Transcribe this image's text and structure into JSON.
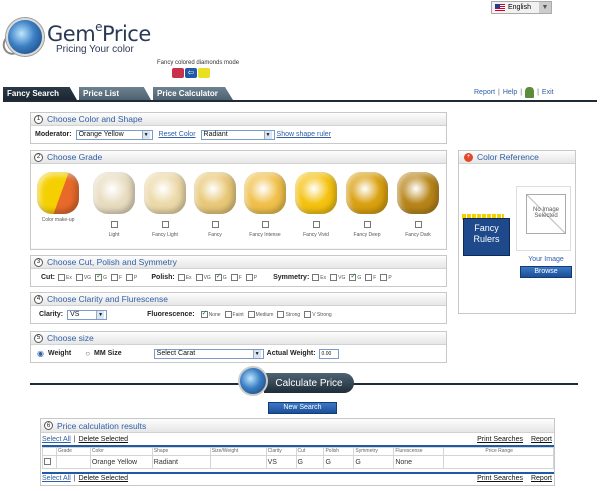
{
  "brand": {
    "name_pre": "Gem",
    "name_sup": "e",
    "name_post": "Price",
    "tagline": "Pricing Your color"
  },
  "language": {
    "selected": "English"
  },
  "mode": {
    "label": "Fancy colored diamonds mode"
  },
  "tabs": [
    {
      "label": "Fancy Search",
      "active": true
    },
    {
      "label": "Price List",
      "active": false
    },
    {
      "label": "Price Calculator",
      "active": false
    }
  ],
  "toplinks": {
    "report": "Report",
    "help": "Help",
    "exit": "Exit",
    "sep": "|"
  },
  "sections": {
    "color": {
      "num": "1",
      "title": "Choose Color and Shape",
      "moderator_label": "Moderator:",
      "moderator_value": "Orange Yellow",
      "reset_label": "Reset Color",
      "shape_value": "Radiant",
      "shape_ruler_label": "Show shape ruler"
    },
    "grade": {
      "num": "2",
      "title": "Choose Grade",
      "makeup_label": "Color make-up",
      "grades": [
        {
          "label": "Light",
          "color": "#e8dcc0"
        },
        {
          "label": "Fancy Light",
          "color": "#ecd9a8"
        },
        {
          "label": "Fancy",
          "color": "#e8c878"
        },
        {
          "label": "Fancy Intense",
          "color": "#f0c04a"
        },
        {
          "label": "Fancy Vivid",
          "color": "#f5c20f"
        },
        {
          "label": "Fancy Deep",
          "color": "#d9a010"
        },
        {
          "label": "Fancy Dark",
          "color": "#b78418"
        }
      ]
    },
    "cut": {
      "num": "3",
      "title": "Choose Cut, Polish and Symmetry",
      "cut_label": "Cut:",
      "polish_label": "Polish:",
      "symmetry_label": "Symmetry:",
      "options": [
        "Ex",
        "VG",
        "G",
        "F",
        "P"
      ]
    },
    "clarity": {
      "num": "4",
      "title": "Choose Clarity and Flurescense",
      "clarity_label": "Clarity:",
      "clarity_value": "VS",
      "fluor_label": "Fluorescence:",
      "fluor_options": [
        "None",
        "Faint",
        "Medium",
        "Strong",
        "V Strong"
      ]
    },
    "size": {
      "num": "5",
      "title": "Choose size",
      "weight_label": "Weight",
      "mm_label": "MM Size",
      "carat_value": "Select Carat",
      "actual_label": "Actual Weight:",
      "actual_value": "0.00"
    }
  },
  "color_reference": {
    "title": "Color Reference",
    "rulers_line1": "Fancy",
    "rulers_line2": "Rulers",
    "noimage_line1": "No Image",
    "noimage_line2": "Selected",
    "your_image": "Your Image",
    "browse": "Browse"
  },
  "calculate": {
    "label": "Calculate Price",
    "new_search": "New Search"
  },
  "results": {
    "num": "6",
    "title": "Price calculation results",
    "select_all": "Select All",
    "delete_selected": "Delete Selected",
    "sep": "|",
    "print_searches": "Print Searches",
    "report": "Report",
    "columns": [
      "",
      "Grade",
      "Color",
      "Shape",
      "Size/Weight",
      "Clarity",
      "Cut",
      "Polish",
      "Symmetry",
      "Flurescense",
      "Price Range"
    ],
    "row": [
      "",
      "",
      "Orange Yellow",
      "Radiant",
      "",
      "VS",
      "G",
      "G",
      "G",
      "None",
      ""
    ]
  },
  "colors": {
    "accent_link": "#2f5fa6",
    "tab_dark": "#1f2c38",
    "blue_button": "#1c4f97"
  }
}
